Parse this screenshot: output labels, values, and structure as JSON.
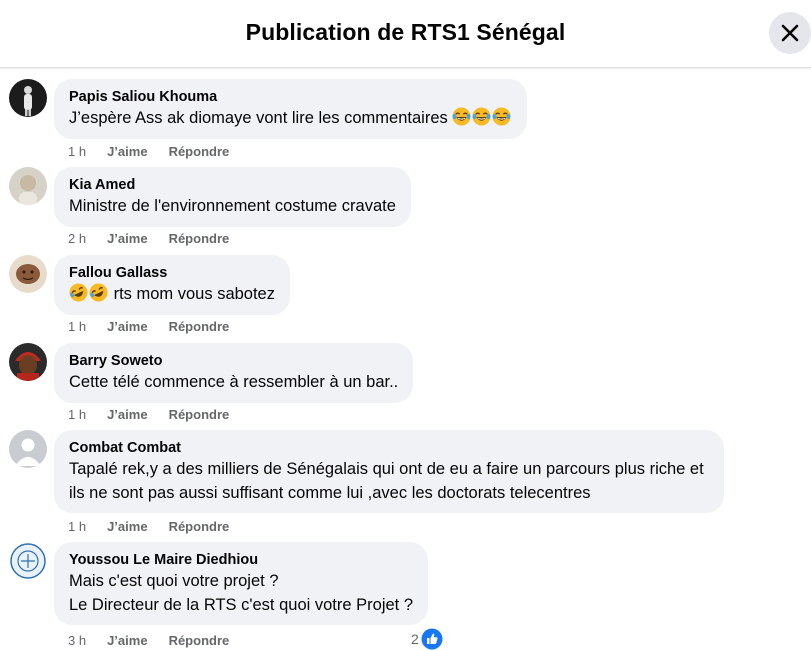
{
  "header": {
    "title": "Publication de RTS1 Sénégal"
  },
  "actions": {
    "like_label": "J’aime",
    "reply_label": "Répondre"
  },
  "comments": [
    {
      "author": "Papis Saliou Khouma",
      "lines": [
        "J’espère Ass ak diomaye vont lire les commentaires"
      ],
      "time": "1 h"
    },
    {
      "author": "Kia Amed",
      "lines": [
        "Ministre de l'environnement costume cravate"
      ],
      "time": "2 h"
    },
    {
      "author": "Fallou Gallass",
      "lines": [
        "rts mom vous sabotez"
      ],
      "time": "1 h"
    },
    {
      "author": "Barry Soweto",
      "lines": [
        "Cette télé commence à ressembler à un bar.."
      ],
      "time": "1 h"
    },
    {
      "author": "Combat Combat",
      "lines": [
        "Tapalé rek,y a des milliers de Sénégalais qui ont de eu a faire un parcours plus riche et",
        "ils ne sont pas aussi suffisant comme lui ,avec les doctorats telecentres"
      ],
      "time": "1 h"
    },
    {
      "author": "Youssou Le Maire Diedhiou",
      "lines": [
        "Mais c'est quoi votre projet ?",
        "Le Directeur de la RTS c'est quoi votre Projet ?"
      ],
      "time": "3 h",
      "reaction_count": "2"
    }
  ],
  "colors": {
    "bubble": "#f0f2f5",
    "meta_text": "#65676b",
    "like_blue": "#1877f2"
  },
  "icons": [
    "close-icon",
    "laughing-crying-emoji",
    "rolling-laughing-emoji",
    "like-reaction-icon"
  ]
}
